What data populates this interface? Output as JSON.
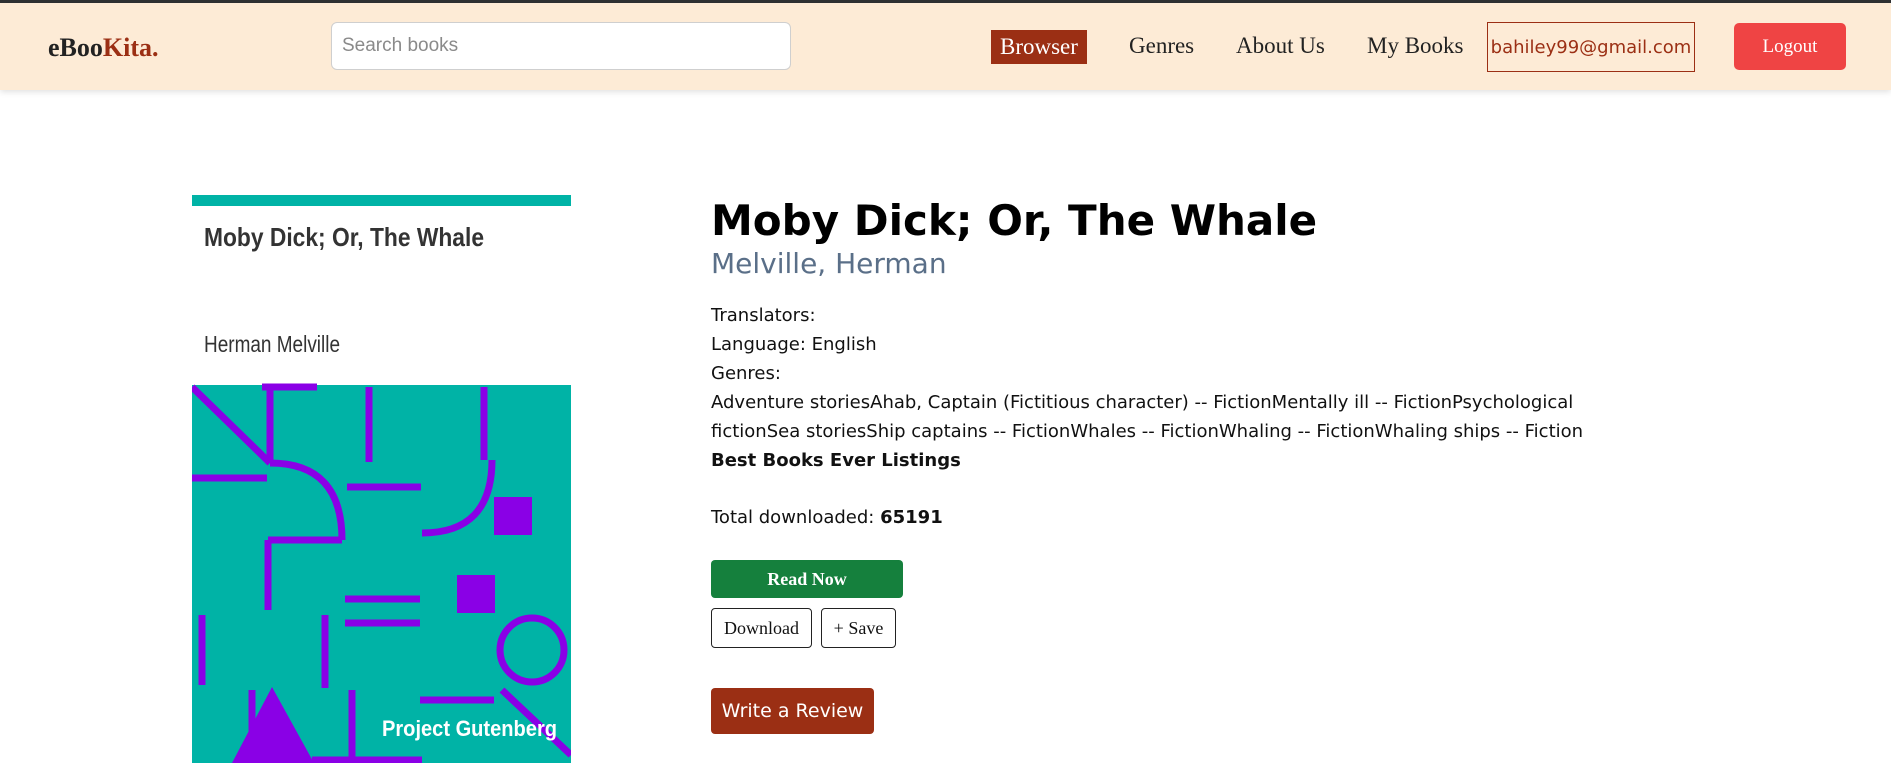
{
  "brand": {
    "name_part1": "eBoo",
    "name_part2": "Kita."
  },
  "search": {
    "placeholder": "Search books",
    "value": ""
  },
  "nav": {
    "browser": "Browser",
    "genres": "Genres",
    "about": "About Us",
    "my_books": "My Books",
    "user_email": "bahiley99@gmail.com",
    "logout": "Logout"
  },
  "book": {
    "title": "Moby Dick; Or, The Whale",
    "author": "Melville, Herman",
    "translators_label": "Translators:",
    "translators_value": "",
    "language_label": "Language:",
    "language_value": "English",
    "genres_label": "Genres:",
    "genres_text": "Adventure storiesAhab, Captain (Fictitious character) -- FictionMentally ill -- FictionPsychological fictionSea storiesShip captains -- FictionWhales -- FictionWhaling -- FictionWhaling ships -- Fiction",
    "bookshelf": "Best Books Ever Listings",
    "downloads_label": "Total downloaded:",
    "downloads_value": "65191"
  },
  "cover": {
    "title": "Moby Dick; Or, The Whale",
    "author": "Herman Melville",
    "publisher": "Project Gutenberg",
    "colors": {
      "bar": "#00b3a6",
      "background": "#00b3a6",
      "shapes": "#8a00e6"
    }
  },
  "actions": {
    "read_now": "Read Now",
    "download": "Download",
    "save": "+ Save",
    "write_review": "Write a Review"
  },
  "colors": {
    "navbar_bg": "#fdebd6",
    "brand_accent": "#9b2f14",
    "logout_bg": "#ef4444",
    "read_now_bg": "#15803d",
    "author_color": "#5a6f88"
  }
}
